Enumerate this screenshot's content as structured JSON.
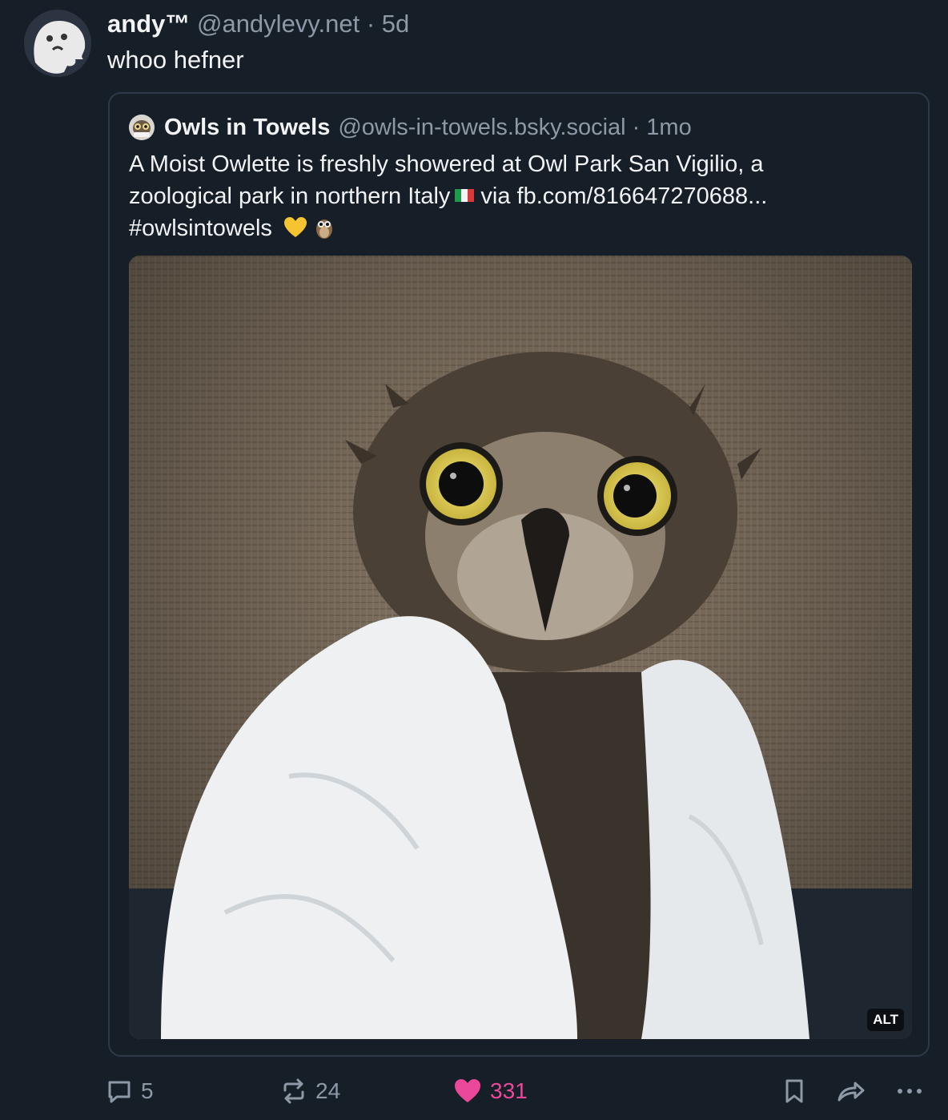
{
  "post": {
    "author_name": "andy™",
    "author_handle": "@andylevy.net",
    "separator": "·",
    "time": "5d",
    "text": "whoo hefner"
  },
  "quote": {
    "author_name": "Owls in Towels",
    "author_handle": "@owls-in-towels.bsky.social",
    "separator": "·",
    "time": "1mo",
    "text_line1": "A Moist Owlette is freshly showered at Owl Park San Vigilio, a",
    "text_line2a": "zoological park in northern Italy",
    "text_line2b": "via fb.com/816647270688...",
    "hashtag": "#owlsintowels",
    "image_alt_label": "ALT"
  },
  "actions": {
    "replies": "5",
    "reposts": "24",
    "likes": "331"
  },
  "colors": {
    "background": "#161e27",
    "muted_text": "#8d99a6",
    "like_pink": "#ec4899",
    "border": "#2e3a48"
  },
  "icons": [
    "ghost-avatar",
    "owl-avatar",
    "italy-flag-icon",
    "yellow-heart-icon",
    "owl-emoji-icon",
    "reply-icon",
    "repost-icon",
    "heart-icon",
    "bookmark-icon",
    "share-icon",
    "more-icon"
  ]
}
